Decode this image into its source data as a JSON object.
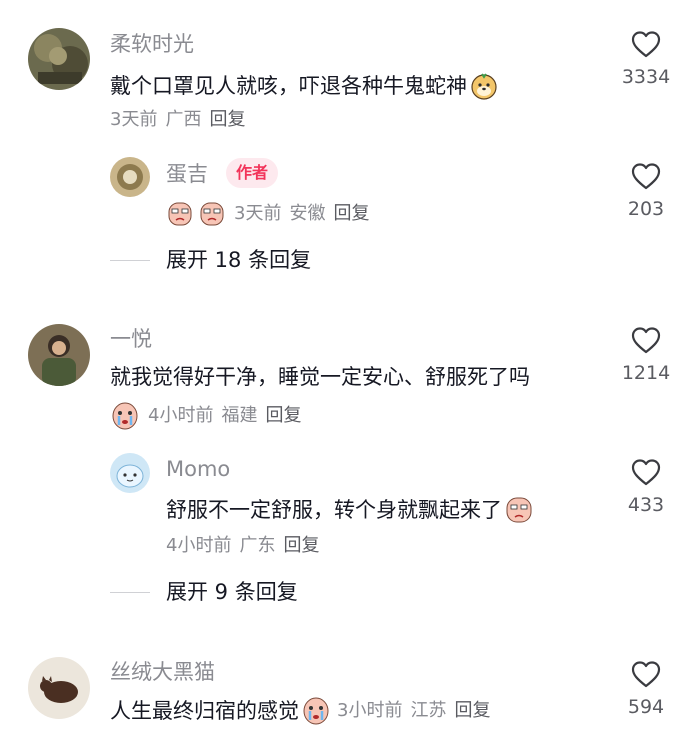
{
  "comments": [
    {
      "username": "柔软时光",
      "text": "戴个口罩见人就咳，吓退各种牛鬼蛇神",
      "time": "3天前",
      "location": "广西",
      "reply_label": "回复",
      "likes": "3334",
      "replies": [
        {
          "username": "蛋吉",
          "badge": "作者",
          "time": "3天前",
          "location": "安徽",
          "reply_label": "回复",
          "likes": "203"
        }
      ],
      "expand_label": "展开 18 条回复"
    },
    {
      "username": "一悦",
      "text": "就我觉得好干净，睡觉一定安心、舒服死了吗",
      "time": "4小时前",
      "location": "福建",
      "reply_label": "回复",
      "likes": "1214",
      "replies": [
        {
          "username": "Momo",
          "text": "舒服不一定舒服，转个身就飘起来了",
          "time": "4小时前",
          "location": "广东",
          "reply_label": "回复",
          "likes": "433"
        }
      ],
      "expand_label": "展开 9 条回复"
    },
    {
      "username": "丝绒大黑猫",
      "text": "人生最终归宿的感觉",
      "time": "3小时前",
      "location": "江苏",
      "reply_label": "回复",
      "likes": "594"
    }
  ],
  "colors": {
    "username": "#8a8b91",
    "text": "#161823",
    "badge_bg": "#fde9ee",
    "badge_text": "#f2345a"
  },
  "icons": {
    "like": "heart-outline-icon",
    "emoji_dog": "shiba-dog-emoji",
    "emoji_cry": "crying-face-emoji"
  }
}
